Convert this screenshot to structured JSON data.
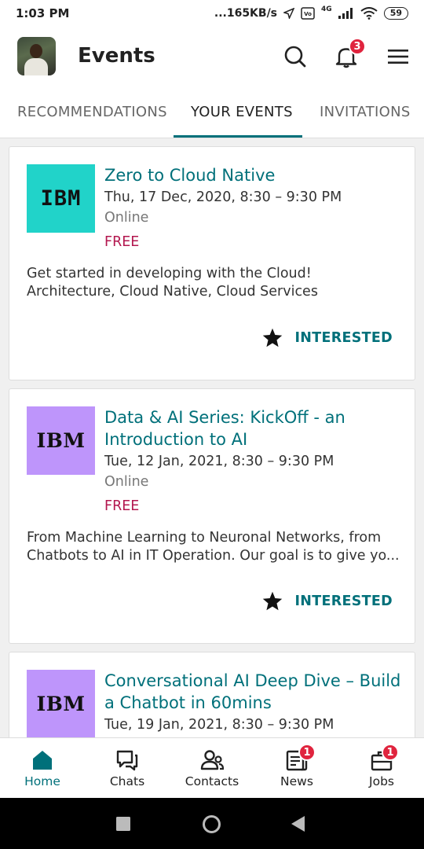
{
  "status_bar": {
    "time": "1:03 PM",
    "speed": "...165KB/s",
    "network": "4G",
    "battery": "59"
  },
  "header": {
    "title": "Events",
    "notification_count": "3"
  },
  "tabs": [
    {
      "label": "RECOMMENDATIONS",
      "active": false
    },
    {
      "label": "YOUR EVENTS",
      "active": true
    },
    {
      "label": "INVITATIONS",
      "active": false
    }
  ],
  "events": [
    {
      "logo_text": "IBM",
      "logo_color": "#21d3c9",
      "title": "Zero to Cloud Native",
      "date": "Thu, 17 Dec, 2020, 8:30 – 9:30 PM",
      "venue": "Online",
      "price": "FREE",
      "description": "Get started in developing with the Cloud! Architecture, Cloud Native, Cloud Services",
      "status": "INTERESTED"
    },
    {
      "logo_text": "IBM",
      "logo_color": "#be95fb",
      "title": "Data & AI Series: KickOff - an Introduction to AI",
      "date": "Tue, 12 Jan, 2021, 8:30 – 9:30 PM",
      "venue": "Online",
      "price": "FREE",
      "description": "From Machine Learning to Neuronal Networks, from Chatbots to AI in IT Operation. Our goal is to give yo...",
      "status": "INTERESTED"
    },
    {
      "logo_text": "IBM",
      "logo_color": "#be95fb",
      "title": "Conversational AI Deep Dive – Build a Chatbot in 60mins",
      "date": "Tue, 19 Jan, 2021, 8:30 – 9:30 PM"
    }
  ],
  "bottom_nav": [
    {
      "label": "Home",
      "icon": "home-icon",
      "badge": ""
    },
    {
      "label": "Chats",
      "icon": "chat-icon",
      "badge": ""
    },
    {
      "label": "Contacts",
      "icon": "contacts-icon",
      "badge": ""
    },
    {
      "label": "News",
      "icon": "news-icon",
      "badge": "1"
    },
    {
      "label": "Jobs",
      "icon": "jobs-icon",
      "badge": "1"
    }
  ],
  "colors": {
    "accent": "#00707a",
    "price": "#b3174f",
    "badge": "#e0243e"
  }
}
